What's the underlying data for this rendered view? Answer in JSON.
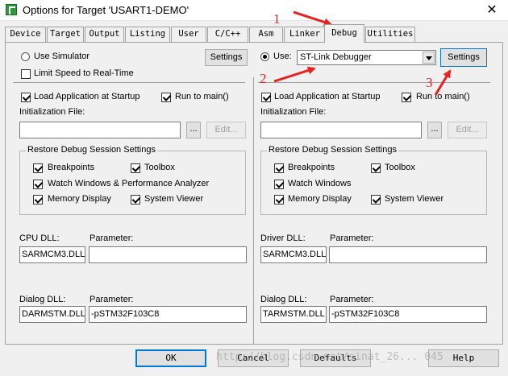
{
  "window": {
    "title": "Options for Target 'USART1-DEMO'",
    "close_glyph": "✕"
  },
  "tabs": [
    {
      "label": "Device"
    },
    {
      "label": "Target"
    },
    {
      "label": "Output"
    },
    {
      "label": "Listing"
    },
    {
      "label": "User"
    },
    {
      "label": "C/C++"
    },
    {
      "label": "Asm"
    },
    {
      "label": "Linker"
    },
    {
      "label": "Debug",
      "active": true
    },
    {
      "label": "Utilities"
    }
  ],
  "left": {
    "use_simulator_label": "Use Simulator",
    "limit_speed_label": "Limit Speed to Real-Time",
    "settings_label": "Settings",
    "load_app_label": "Load Application at Startup",
    "run_to_main_label": "Run to main()",
    "init_file_label": "Initialization File:",
    "init_file_value": "",
    "browse_label": "...",
    "edit_label": "Edit...",
    "restore_group_title": "Restore Debug Session Settings",
    "breakpoints_label": "Breakpoints",
    "toolbox_label": "Toolbox",
    "watch_label": "Watch Windows & Performance Analyzer",
    "memory_label": "Memory Display",
    "system_viewer_label": "System Viewer",
    "cpu_dll_label": "CPU DLL:",
    "cpu_dll_value": "SARMCM3.DLL",
    "param_label": "Parameter:",
    "cpu_param_value": "",
    "dialog_dll_label": "Dialog DLL:",
    "dialog_dll_value": "DARMSTM.DLL",
    "dialog_param_value": "-pSTM32F103C8"
  },
  "right": {
    "use_label": "Use:",
    "debugger_value": "ST-Link Debugger",
    "settings_label": "Settings",
    "load_app_label": "Load Application at Startup",
    "run_to_main_label": "Run to main()",
    "init_file_label": "Initialization File:",
    "init_file_value": "",
    "browse_label": "...",
    "edit_label": "Edit...",
    "restore_group_title": "Restore Debug Session Settings",
    "breakpoints_label": "Breakpoints",
    "toolbox_label": "Toolbox",
    "watch_label": "Watch Windows",
    "memory_label": "Memory Display",
    "system_viewer_label": "System Viewer",
    "driver_dll_label": "Driver DLL:",
    "driver_dll_value": "SARMCM3.DLL",
    "param_label": "Parameter:",
    "driver_param_value": "",
    "dialog_dll_label": "Dialog DLL:",
    "dialog_dll_value": "TARMSTM.DLL",
    "dialog_param_value": "-pSTM32F103C8"
  },
  "footer": {
    "ok": "OK",
    "cancel": "Cancel",
    "defaults": "Defaults",
    "help": "Help"
  },
  "annotations": {
    "n1": "1",
    "n2": "2",
    "n3": "3",
    "color": "#e82020"
  },
  "watermark": "http://blog.csdn.net/sinat_26... 045"
}
